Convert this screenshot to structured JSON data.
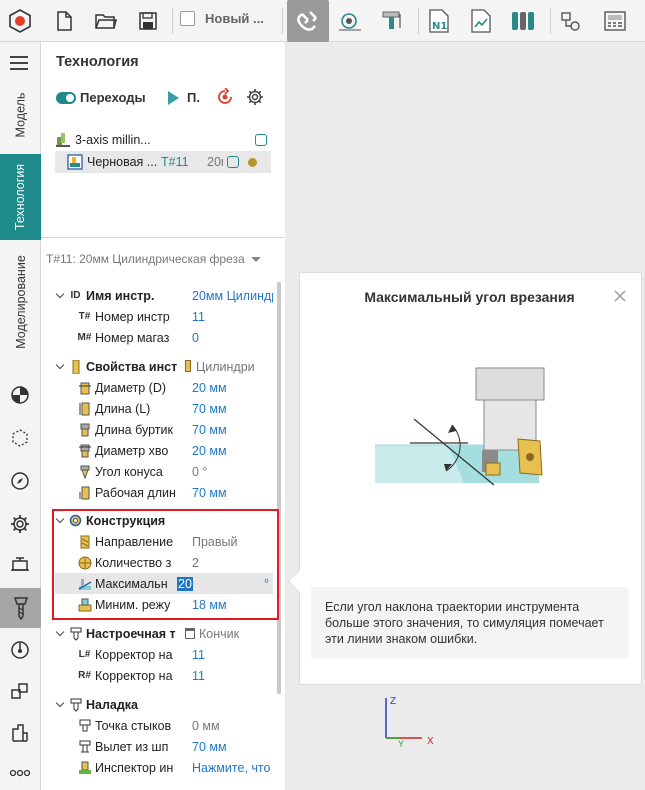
{
  "toolbar": {
    "project_name": "Новый ..."
  },
  "rail": {
    "tabs": [
      "Модель",
      "Технология",
      "Моделирование"
    ]
  },
  "technology": {
    "title": "Технология",
    "transitions_label": "Переходы",
    "play_label": "П.",
    "tree": [
      {
        "name": "3-axis millin..."
      },
      {
        "name": "Черновая ...",
        "tool": "T#11",
        "extra": "20r"
      }
    ]
  },
  "props": {
    "tool_selector": "T#11: 20мм Цилиндрическая фреза",
    "groups": {
      "id": {
        "icon": "ID",
        "label": "Имя инстр.",
        "value": "20мм Цилиндр"
      },
      "tool_number": {
        "icon": "T#",
        "label": "Номер инстр",
        "value": "11"
      },
      "magazine_number": {
        "icon": "M#",
        "label": "Номер магаз",
        "value": "0"
      },
      "tool_props": {
        "label": "Свойства инст",
        "value": "Цилиндри"
      },
      "diameter": {
        "label": "Диаметр (D)",
        "value": "20 мм"
      },
      "length": {
        "label": "Длина (L)",
        "value": "70 мм"
      },
      "collar_length": {
        "label": "Длина буртик",
        "value": "70 мм"
      },
      "shank_diameter": {
        "label": "Диаметр хво",
        "value": "20 мм"
      },
      "taper_angle": {
        "label": "Угол конуса",
        "value": "0 °"
      },
      "working_length": {
        "label": "Рабочая длин",
        "value": "70 мм"
      },
      "construction": {
        "label": "Конструкция"
      },
      "direction": {
        "label": "Направление",
        "value": "Правый"
      },
      "count": {
        "label": "Количество з",
        "value": "2"
      },
      "max_angle": {
        "label": "Максимальн",
        "value": "20",
        "unit": "°"
      },
      "min_mode": {
        "label": "Миним. режу",
        "value": "18 мм"
      },
      "setup": {
        "label": "Настроечная т",
        "value": "Кончик"
      },
      "length_corrector": {
        "icon": "L#",
        "label": "Корректор на",
        "value": "11"
      },
      "radius_corrector": {
        "icon": "R#",
        "label": "Корректор на",
        "value": "11"
      },
      "adjustment": {
        "label": "Наладка"
      },
      "joint_point": {
        "label": "Точка стыков",
        "value": "0 мм"
      },
      "overhang": {
        "label": "Вылет из шп",
        "value": "70 мм"
      },
      "inspector": {
        "label": "Инспектор ин",
        "value": "Нажмите, что"
      }
    }
  },
  "tooltip": {
    "title": "Максимальный угол врезания",
    "description": "Если угол наклона траектории инструмента больше этого значения, то симуляция помечает эти линии знаком ошибки."
  },
  "axes": {
    "z": "Z",
    "y": "Y",
    "x": "X"
  },
  "colors": {
    "accent": "#1f8a8a",
    "value_blue": "#1f76c9",
    "highlight_red": "#e01b24"
  }
}
